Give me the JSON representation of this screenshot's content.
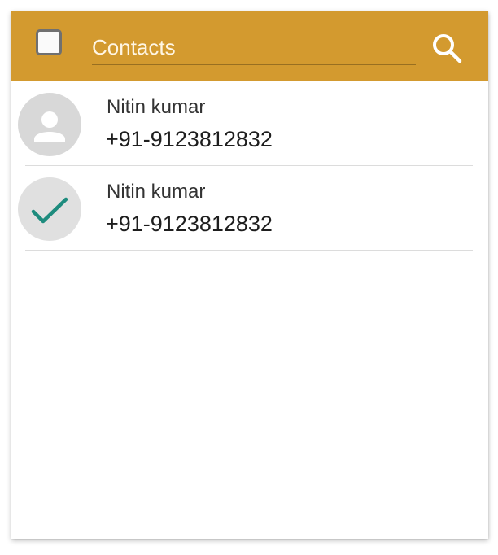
{
  "header": {
    "select_all_checked": false,
    "search_placeholder": "Contacts",
    "search_value": "",
    "search_icon": "search-icon",
    "background_color": "#d39a2f"
  },
  "contacts": [
    {
      "name": "Nitin kumar",
      "phone": "+91-9123812832",
      "selected": false,
      "avatar_icon": "person-icon"
    },
    {
      "name": "Nitin kumar",
      "phone": "+91-9123812832",
      "selected": true,
      "avatar_icon": "checkmark-icon",
      "check_color": "#1e8c7e"
    }
  ]
}
